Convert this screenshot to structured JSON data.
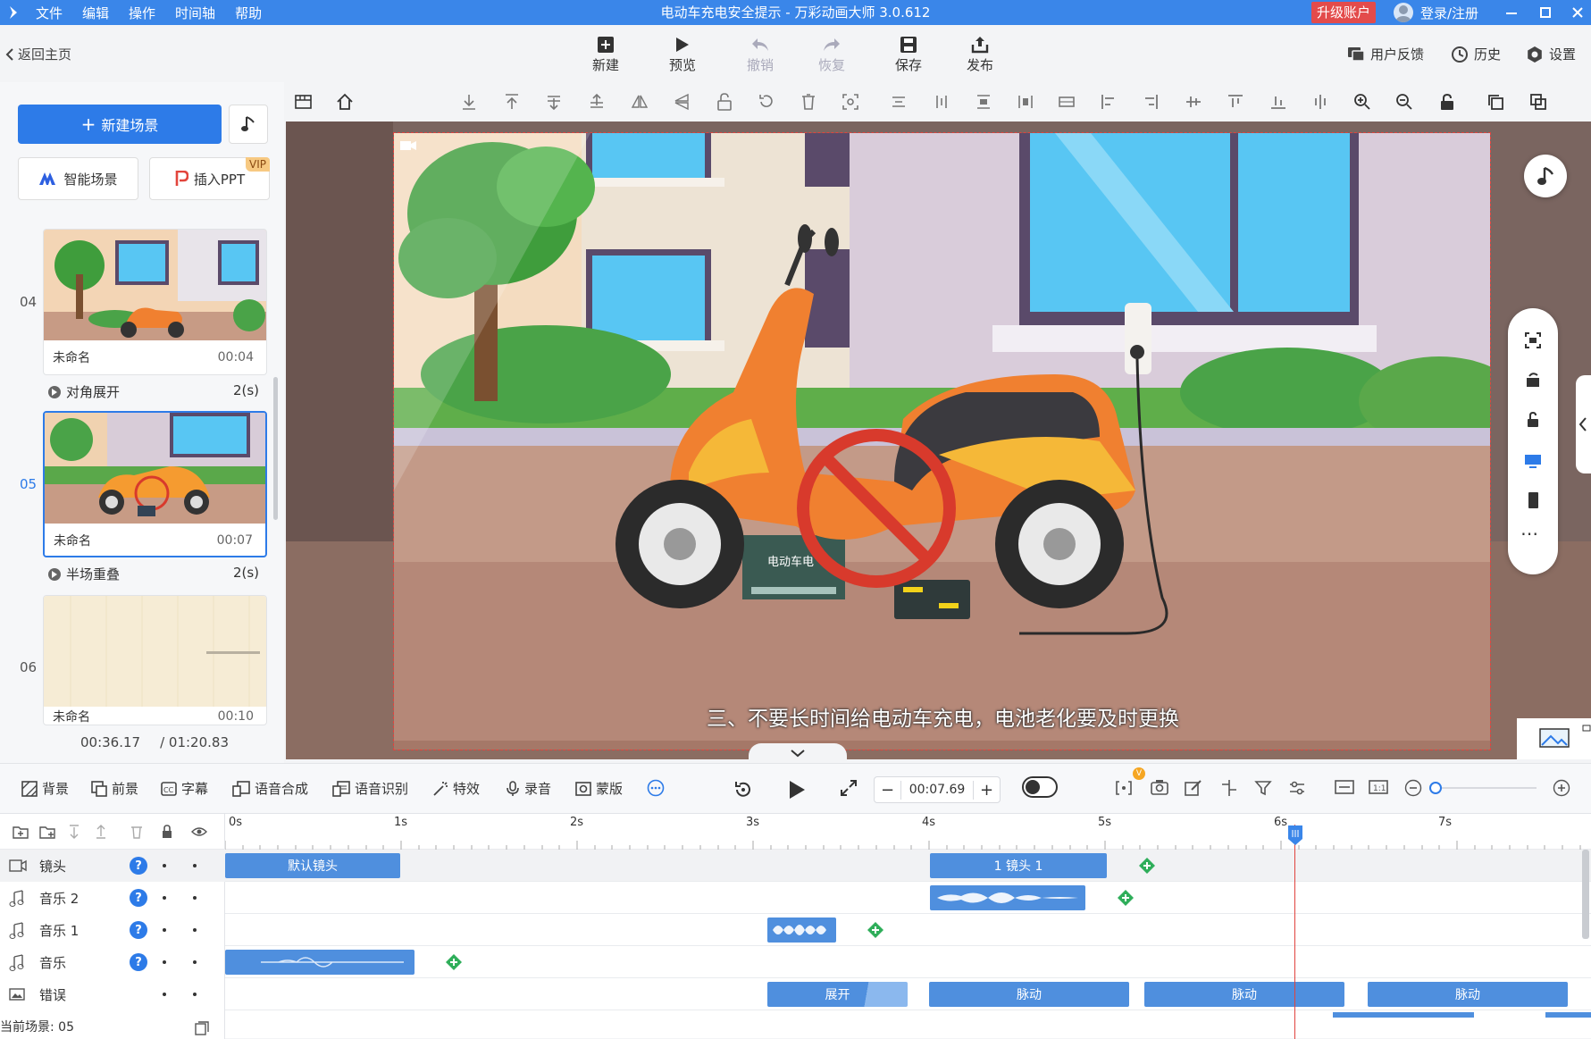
{
  "app": {
    "title": "电动车充电安全提示 - 万彩动画大师 3.0.612",
    "menu": [
      "文件",
      "编辑",
      "操作",
      "时间轴",
      "帮助"
    ],
    "upgrade": "升级账户",
    "login": "登录/注册"
  },
  "toolbar": {
    "back": "返回主页",
    "new": "新建",
    "preview": "预览",
    "undo": "撤销",
    "redo": "恢复",
    "save": "保存",
    "publish": "发布",
    "feedback": "用户反馈",
    "history": "历史",
    "settings": "设置"
  },
  "left": {
    "new_scene": "新建场景",
    "smart_scene": "智能场景",
    "insert_ppt": "插入PPT",
    "vip": "VIP",
    "scenes": [
      {
        "no": "04",
        "name": "未命名",
        "time": "00:04"
      },
      {
        "no": "05",
        "name": "未命名",
        "time": "00:07"
      },
      {
        "no": "06",
        "name": "未命名",
        "time": "00:10"
      }
    ],
    "transitions": [
      {
        "name": "对角展开",
        "dur": "2(s)"
      },
      {
        "name": "半场重叠",
        "dur": "2(s)"
      }
    ],
    "current_time": "00:36.17",
    "total_time": "/ 01:20.83"
  },
  "canvas": {
    "subtitle": "三、不要长时间给电动车充电，电池老化要及时更换",
    "battery_label": "电动车电"
  },
  "timeline_tools": {
    "background": "背景",
    "foreground": "前景",
    "caption": "字幕",
    "tts": "语音合成",
    "asr": "语音识别",
    "effects": "特效",
    "record": "录音",
    "mask": "蒙版",
    "time": "00:07.69",
    "v_badge": "V"
  },
  "timeline": {
    "ticks": [
      "0s",
      "1s",
      "2s",
      "3s",
      "4s",
      "5s",
      "6s",
      "7s"
    ],
    "tracks": [
      {
        "name": "镜头"
      },
      {
        "name": "音乐 2"
      },
      {
        "name": "音乐 1"
      },
      {
        "name": "音乐"
      },
      {
        "name": "错误"
      }
    ],
    "clips": {
      "default_camera": "默认镜头",
      "camera1": "1 镜头 1",
      "expand": "展开",
      "pulse1": "脉动",
      "pulse2": "脉动",
      "pulse3": "脉动"
    },
    "current_scene": "当前场景: 05"
  },
  "colors": {
    "accent": "#2d7be8",
    "titlebar": "#3a86e9",
    "upgrade": "#e34b4b",
    "playhead": "#e0433e",
    "clip": "#4f8fde"
  }
}
